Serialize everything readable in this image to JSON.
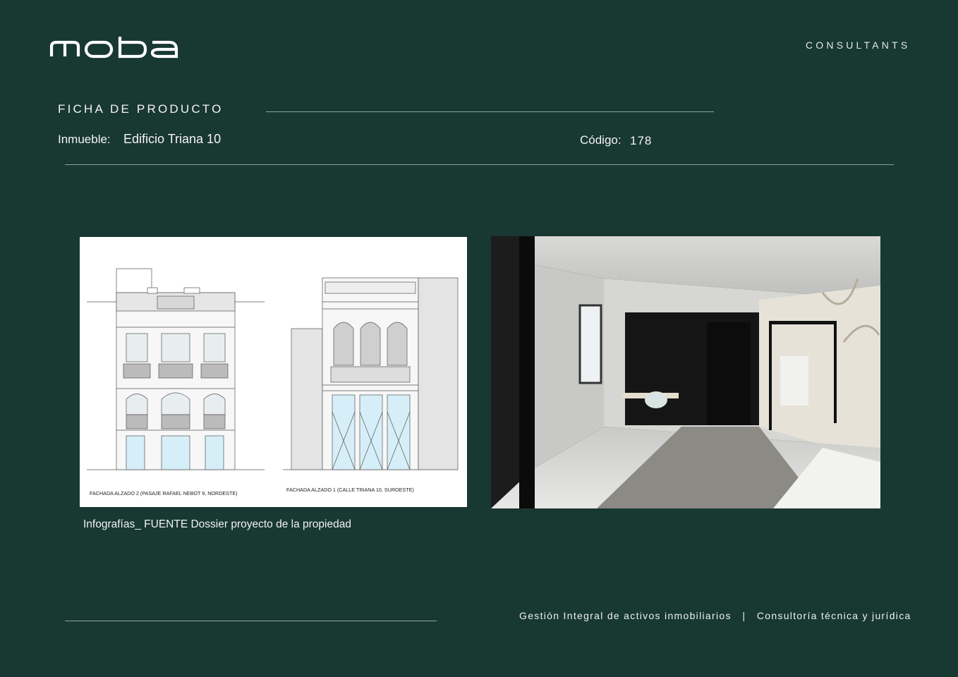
{
  "brand": {
    "logo_text": "moba",
    "tagline": "CONSULTANTS"
  },
  "header": {
    "section_title": "FICHA DE PRODUCTO",
    "property_label": "Inmueble:",
    "property_value": "Edificio Triana 10",
    "code_label": "Código:",
    "code_value": "178"
  },
  "figures": {
    "elevation_left_label": "FACHADA ALZADO 2 (PASAJE RAFAEL NEBOT 9, NORDESTE)",
    "elevation_right_label": "FACHADA ALZADO 1 (CALLE TRIANA 10, SUROESTE)",
    "caption": "Infografías_ FUENTE Dossier proyecto de la propiedad"
  },
  "footer": {
    "text": "Gestión Integral de activos inmobiliarios   |   Consultoría técnica y jurídica"
  }
}
